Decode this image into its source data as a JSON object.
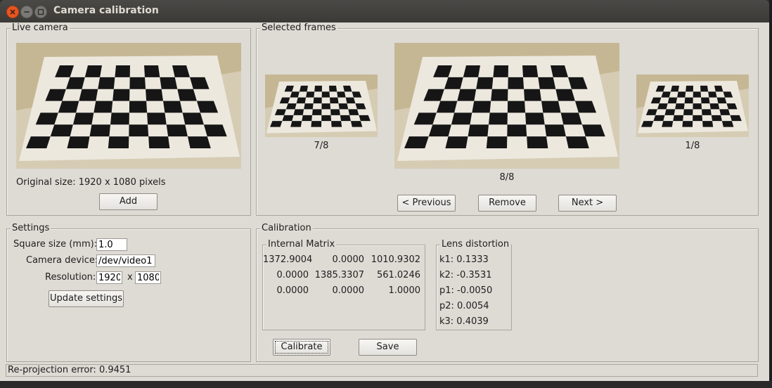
{
  "window": {
    "title": "Camera calibration",
    "close_icon": "close-icon",
    "minimize_icon": "minimize-icon",
    "maximize_icon": "maximize-icon"
  },
  "live_camera": {
    "legend": "Live camera",
    "original_size": "Original size: 1920 x 1080 pixels",
    "add_label": "Add"
  },
  "selected_frames": {
    "legend": "Selected frames",
    "left_caption": "7/8",
    "center_caption": "8/8",
    "right_caption": "1/8",
    "previous_label": "< Previous",
    "remove_label": "Remove",
    "next_label": "Next >"
  },
  "settings": {
    "legend": "Settings",
    "square_size_label": "Square size (mm):",
    "square_size_value": "1.0",
    "camera_device_label": "Camera device:",
    "camera_device_value": "/dev/video1",
    "resolution_label": "Resolution:",
    "resolution_width": "1920",
    "resolution_x": "x",
    "resolution_height": "1080",
    "update_label": "Update settings"
  },
  "calibration": {
    "legend": "Calibration",
    "matrix_legend": "Internal Matrix",
    "matrix": [
      [
        "1372.9004",
        "0.0000",
        "1010.9302"
      ],
      [
        "0.0000",
        "1385.3307",
        "561.0246"
      ],
      [
        "0.0000",
        "0.0000",
        "1.0000"
      ]
    ],
    "distortion_legend": "Lens distortion",
    "distortion": [
      "k1: 0.1333",
      "k2: -0.3531",
      "p1: -0.0050",
      "p2: 0.0054",
      "k3: 0.4039"
    ],
    "calibrate_label": "Calibrate",
    "save_label": "Save"
  },
  "status": {
    "text": "Re-projection error: 0.9451"
  },
  "colors": {
    "window_bg": "#dedbd5",
    "titlebar": "#3c3b37",
    "close_button": "#e95420",
    "photo_bg": "#c4b48f"
  }
}
